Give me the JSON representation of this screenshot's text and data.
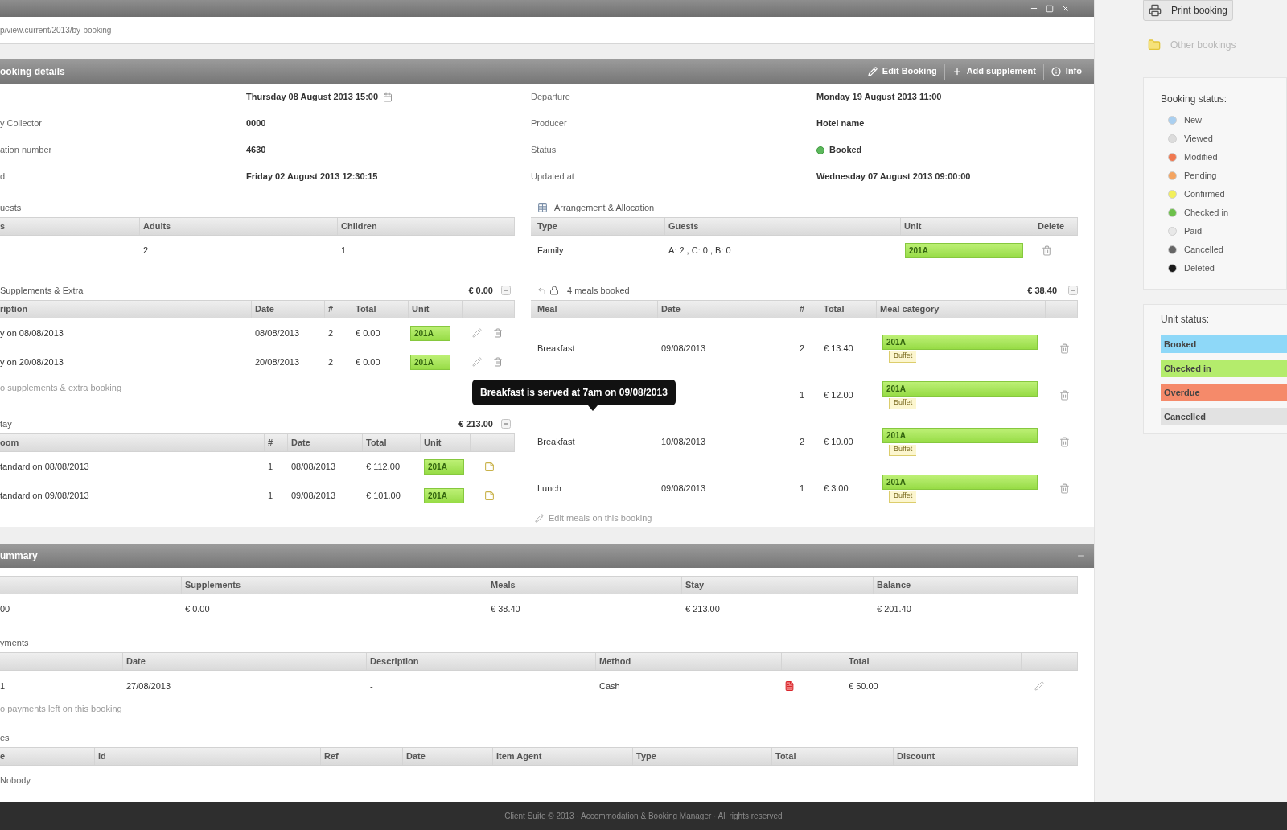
{
  "breadcrumb": "p/view.current/2013/by-booking",
  "booking_panel": {
    "title": "ooking details",
    "actions": [
      {
        "label": "Edit Booking",
        "kind": "edit"
      },
      {
        "label": "Add supplement",
        "kind": "add"
      },
      {
        "label": "Info",
        "kind": "info"
      }
    ],
    "details": [
      {
        "value": "Thursday 08 August 2013 15:00",
        "kind": "date"
      },
      {
        "label": "Departure",
        "value": "Monday 19 August 2013 11:00",
        "kind": "text"
      },
      {
        "label": "y Collector",
        "value": "0000",
        "kind": "text"
      },
      {
        "label": "Producer",
        "value": "Hotel name",
        "kind": "text"
      },
      {
        "label": "ation number",
        "value": "4630",
        "kind": "text"
      },
      {
        "label": "Status",
        "value": "Booked",
        "kind": "status"
      },
      {
        "label": "d",
        "value": "Friday 02 August 2013 12:30:15",
        "kind": "text"
      },
      {
        "label": "Updated at",
        "value": "Wednesday 07 August 2013 09:00:00",
        "kind": "text"
      }
    ],
    "guests": {
      "title": "uests",
      "columns": [
        "s",
        "Adults",
        "Children"
      ],
      "rows": [
        {
          "adults": "2",
          "children": "1"
        }
      ]
    },
    "arrangement": {
      "title": "Arrangement & Allocation",
      "columns": [
        "Type",
        "Guests",
        "Unit",
        "Delete"
      ],
      "rows": [
        {
          "type": "Family",
          "guests": "A: 2 , C: 0 , B: 0",
          "unit": "201A"
        }
      ]
    },
    "supplements": {
      "title": "Supplements & Extra",
      "total": "€ 0.00",
      "columns": [
        "ription",
        "Date",
        "#",
        "Total",
        "Unit"
      ],
      "rows": [
        {
          "description": "y on 08/08/2013",
          "date": "08/08/2013",
          "count": "2",
          "total": "€ 0.00",
          "unit": "201A"
        },
        {
          "description": "y on 20/08/2013",
          "date": "20/08/2013",
          "count": "2",
          "total": "€ 0.00",
          "unit": "201A"
        }
      ],
      "note": "o supplements & extra booking"
    },
    "meals": {
      "title": "4 meals booked",
      "total": "€ 38.40",
      "columns": [
        "Meal",
        "Date",
        "#",
        "Total",
        "Meal category"
      ],
      "rows": [
        {
          "meal": "Breakfast",
          "date": "09/08/2013",
          "count": "2",
          "total": "€ 13.40",
          "unit": "201A",
          "tag": "Buffet"
        },
        {
          "count": "1",
          "total": "€ 12.00",
          "unit": "201A",
          "tag": "Buffet"
        },
        {
          "meal": "Breakfast",
          "date": "10/08/2013",
          "count": "2",
          "total": "€ 10.00",
          "unit": "201A",
          "tag": "Buffet"
        },
        {
          "meal": "Lunch",
          "date": "09/08/2013",
          "count": "1",
          "total": "€ 3.00",
          "unit": "201A",
          "tag": "Buffet"
        }
      ],
      "footer": "Edit meals on this booking",
      "tooltip": "Breakfast is served at 7am on 09/08/2013"
    },
    "stay": {
      "title": "tay",
      "total": "€ 213.00",
      "columns": [
        "oom",
        "#",
        "Date",
        "Total",
        "Unit"
      ],
      "rows": [
        {
          "description": "tandard on 08/08/2013",
          "count": "1",
          "date": "08/08/2013",
          "total": "€ 112.00",
          "unit": "201A"
        },
        {
          "description": "tandard on 09/08/2013",
          "count": "1",
          "date": "09/08/2013",
          "total": "€ 101.00",
          "unit": "201A"
        }
      ]
    }
  },
  "summary_panel": {
    "title": "ummary",
    "totals": {
      "columns": [
        "Supplements",
        "Meals",
        "Stay",
        "Balance"
      ],
      "rows": [
        {
          "ref": "00",
          "values": [
            "€ 0.00",
            "€ 38.40",
            "€ 213.00",
            "€ 201.40"
          ]
        }
      ]
    },
    "payments": {
      "title": "yments",
      "columns": [
        "Date",
        "Description",
        "Method",
        "Total"
      ],
      "rows": [
        {
          "number": "1",
          "date": "27/08/2013",
          "description": "-",
          "method": "Cash",
          "total": "€ 50.00"
        }
      ],
      "note": "o payments left on this booking"
    },
    "invoices": {
      "title": "es",
      "columns": [
        "e",
        "Id",
        "Ref",
        "Date",
        "Item Agent",
        "Type",
        "Total",
        "Discount"
      ],
      "empty": "Nobody"
    }
  },
  "sidebar": {
    "actions": [
      {
        "label": "Print booking",
        "kind": "print",
        "disabled": false
      },
      {
        "label": "Other bookings",
        "kind": "folder",
        "disabled": true
      }
    ],
    "booking_status": {
      "title": "Booking status:",
      "items": [
        {
          "label": "New",
          "color": "#a9cff0"
        },
        {
          "label": "Viewed",
          "color": "#dcdcdc"
        },
        {
          "label": "Modified",
          "color": "#f07850"
        },
        {
          "label": "Pending",
          "color": "#f4a460"
        },
        {
          "label": "Confirmed",
          "color": "#f2ef5a"
        },
        {
          "label": "Checked in",
          "color": "#6cc04a"
        },
        {
          "label": "Paid",
          "color": "#e8e8e8"
        },
        {
          "label": "Cancelled",
          "color": "#666666"
        },
        {
          "label": "Deleted",
          "color": "#1a1a1a"
        }
      ]
    },
    "unit_status": {
      "title": "Unit status:",
      "items": [
        {
          "label": "Booked",
          "color": "#8ed8f8"
        },
        {
          "label": "Checked in",
          "color": "#b4ec6c"
        },
        {
          "label": "Overdue",
          "color": "#f58a6a"
        },
        {
          "label": "Cancelled",
          "color": "#e2e2e2"
        }
      ]
    }
  },
  "footer": "Client Suite © 2013 · Accommodation & Booking Manager · All rights reserved"
}
